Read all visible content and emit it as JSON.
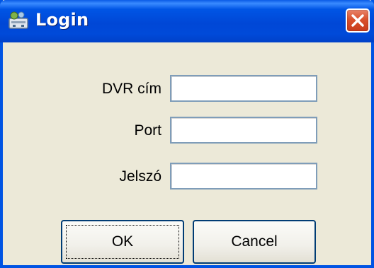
{
  "window": {
    "title": "Login",
    "icon": "dvr-app-icon",
    "close_icon": "close-icon"
  },
  "form": {
    "fields": [
      {
        "label": "DVR cím",
        "value": ""
      },
      {
        "label": "Port",
        "value": ""
      },
      {
        "label": "Jelszó",
        "value": ""
      }
    ]
  },
  "buttons": {
    "ok_label": "OK",
    "cancel_label": "Cancel"
  },
  "colors": {
    "titlebar": "#0054e3",
    "window_bg": "#ece9d8",
    "close_button": "#d9512c",
    "input_border": "#7f9db9",
    "button_border": "#003c74"
  }
}
